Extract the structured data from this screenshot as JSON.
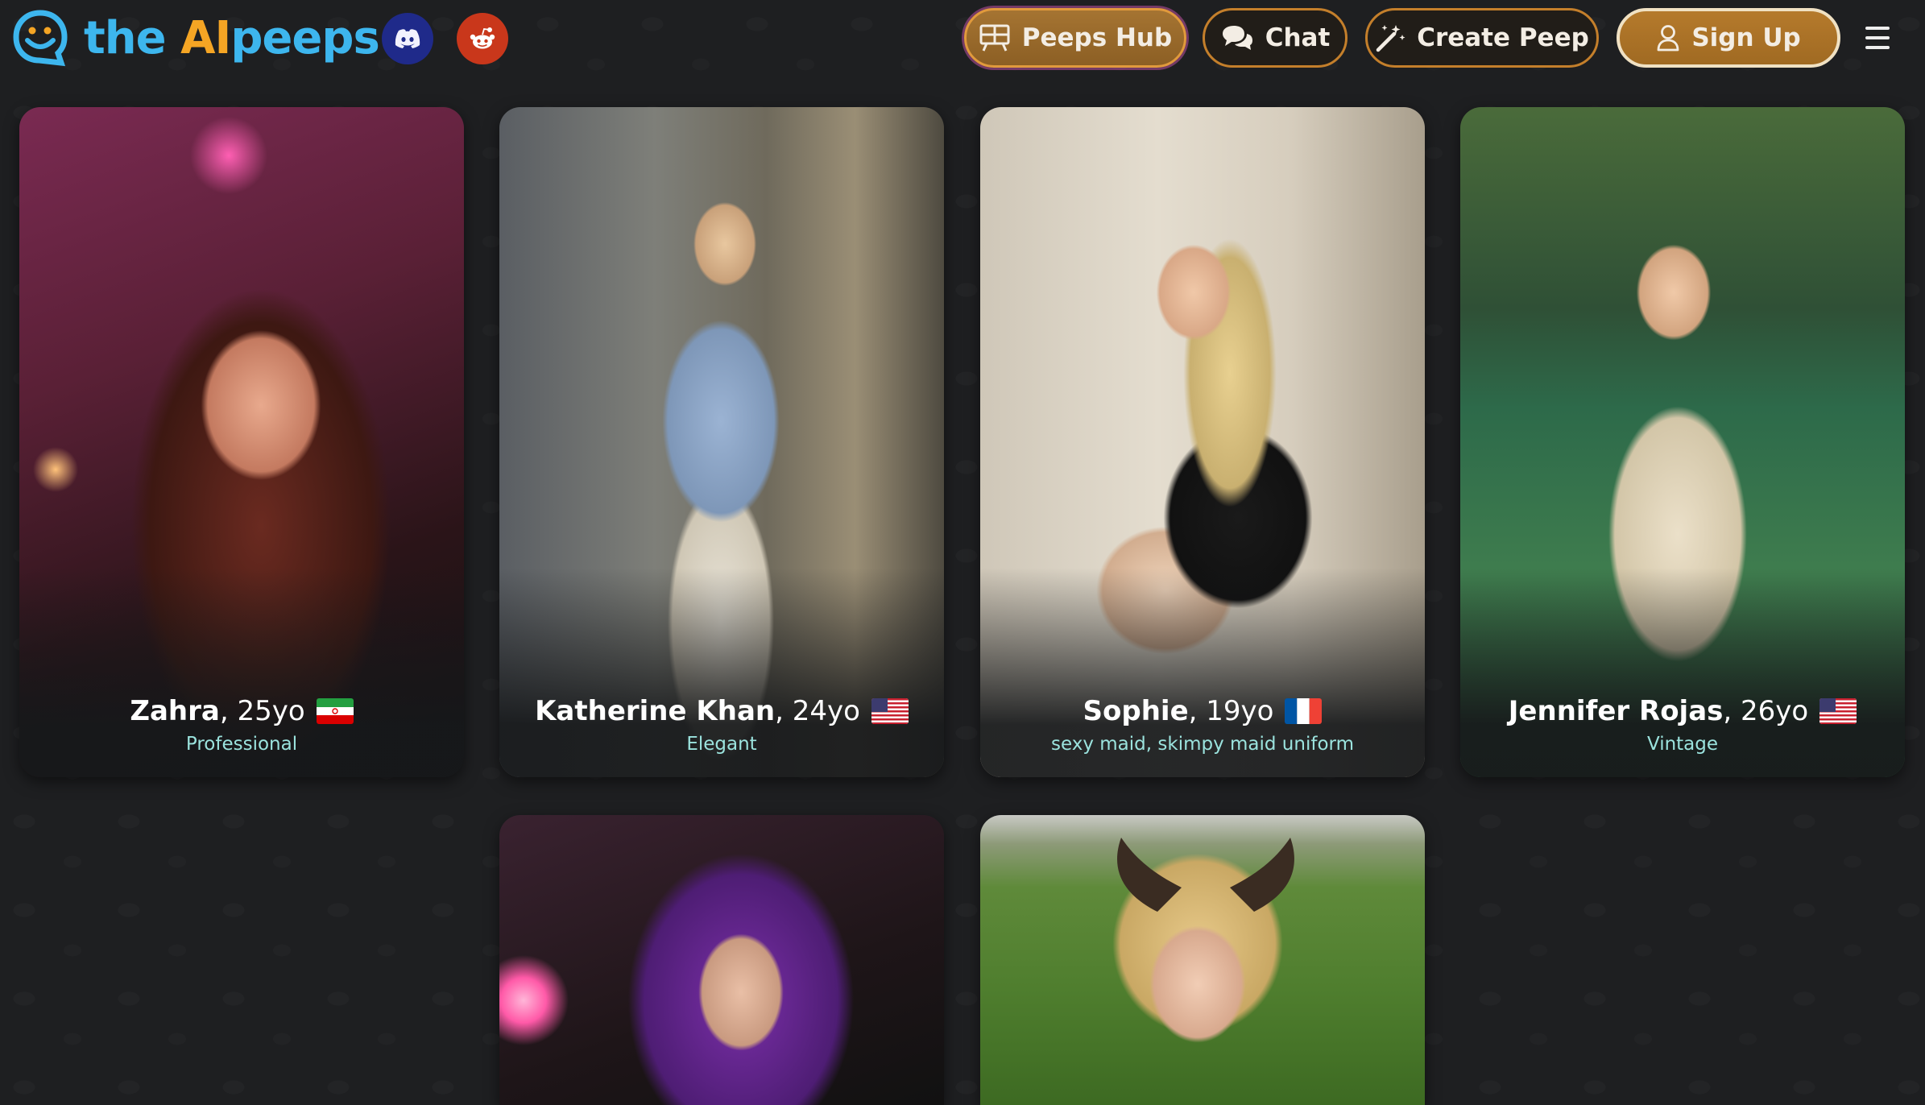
{
  "header": {
    "logo": {
      "prefix": "the ",
      "ai": "AI",
      "suffix": "peeps"
    },
    "social": [
      {
        "icon": "discord-icon",
        "color": "#1f2a8a"
      },
      {
        "icon": "reddit-icon",
        "color": "#c9371b"
      }
    ],
    "nav": {
      "peeps_hub": "Peeps Hub",
      "chat": "Chat",
      "create_peep": "Create Peep",
      "sign_up": "Sign Up"
    },
    "menu_icon": "hamburger-menu-icon"
  },
  "colors": {
    "background": "#1e1f21",
    "brand_blue": "#3db6ee",
    "brand_orange": "#f5a524",
    "button_accent": "#c47f2b",
    "tag_text": "#9be3de"
  },
  "peeps": [
    {
      "name": "Zahra",
      "age": ", 25yo",
      "flag": "iran-flag",
      "tag": "Professional"
    },
    {
      "name": "Katherine Khan",
      "age": ", 24yo",
      "flag": "usa-flag",
      "tag": "Elegant"
    },
    {
      "name": "Sophie",
      "age": ", 19yo",
      "flag": "france-flag",
      "tag": "sexy maid, skimpy maid uniform"
    },
    {
      "name": "Jennifer Rojas",
      "age": ", 26yo",
      "flag": "usa-flag",
      "tag": "Vintage"
    }
  ]
}
